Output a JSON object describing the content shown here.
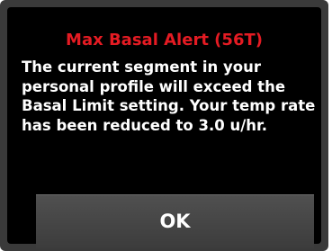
{
  "alert": {
    "title": "Max Basal Alert (56T)",
    "message_lines": [
      "The current segment in your",
      "personal profile will exceed the",
      "Basal Limit setting. Your temp rate",
      "has been reduced to 3.0 u/hr."
    ],
    "title_color": "#e41b23",
    "background_color": "#000000",
    "text_color": "#ffffff"
  },
  "buttons": {
    "ok_label": "OK"
  }
}
